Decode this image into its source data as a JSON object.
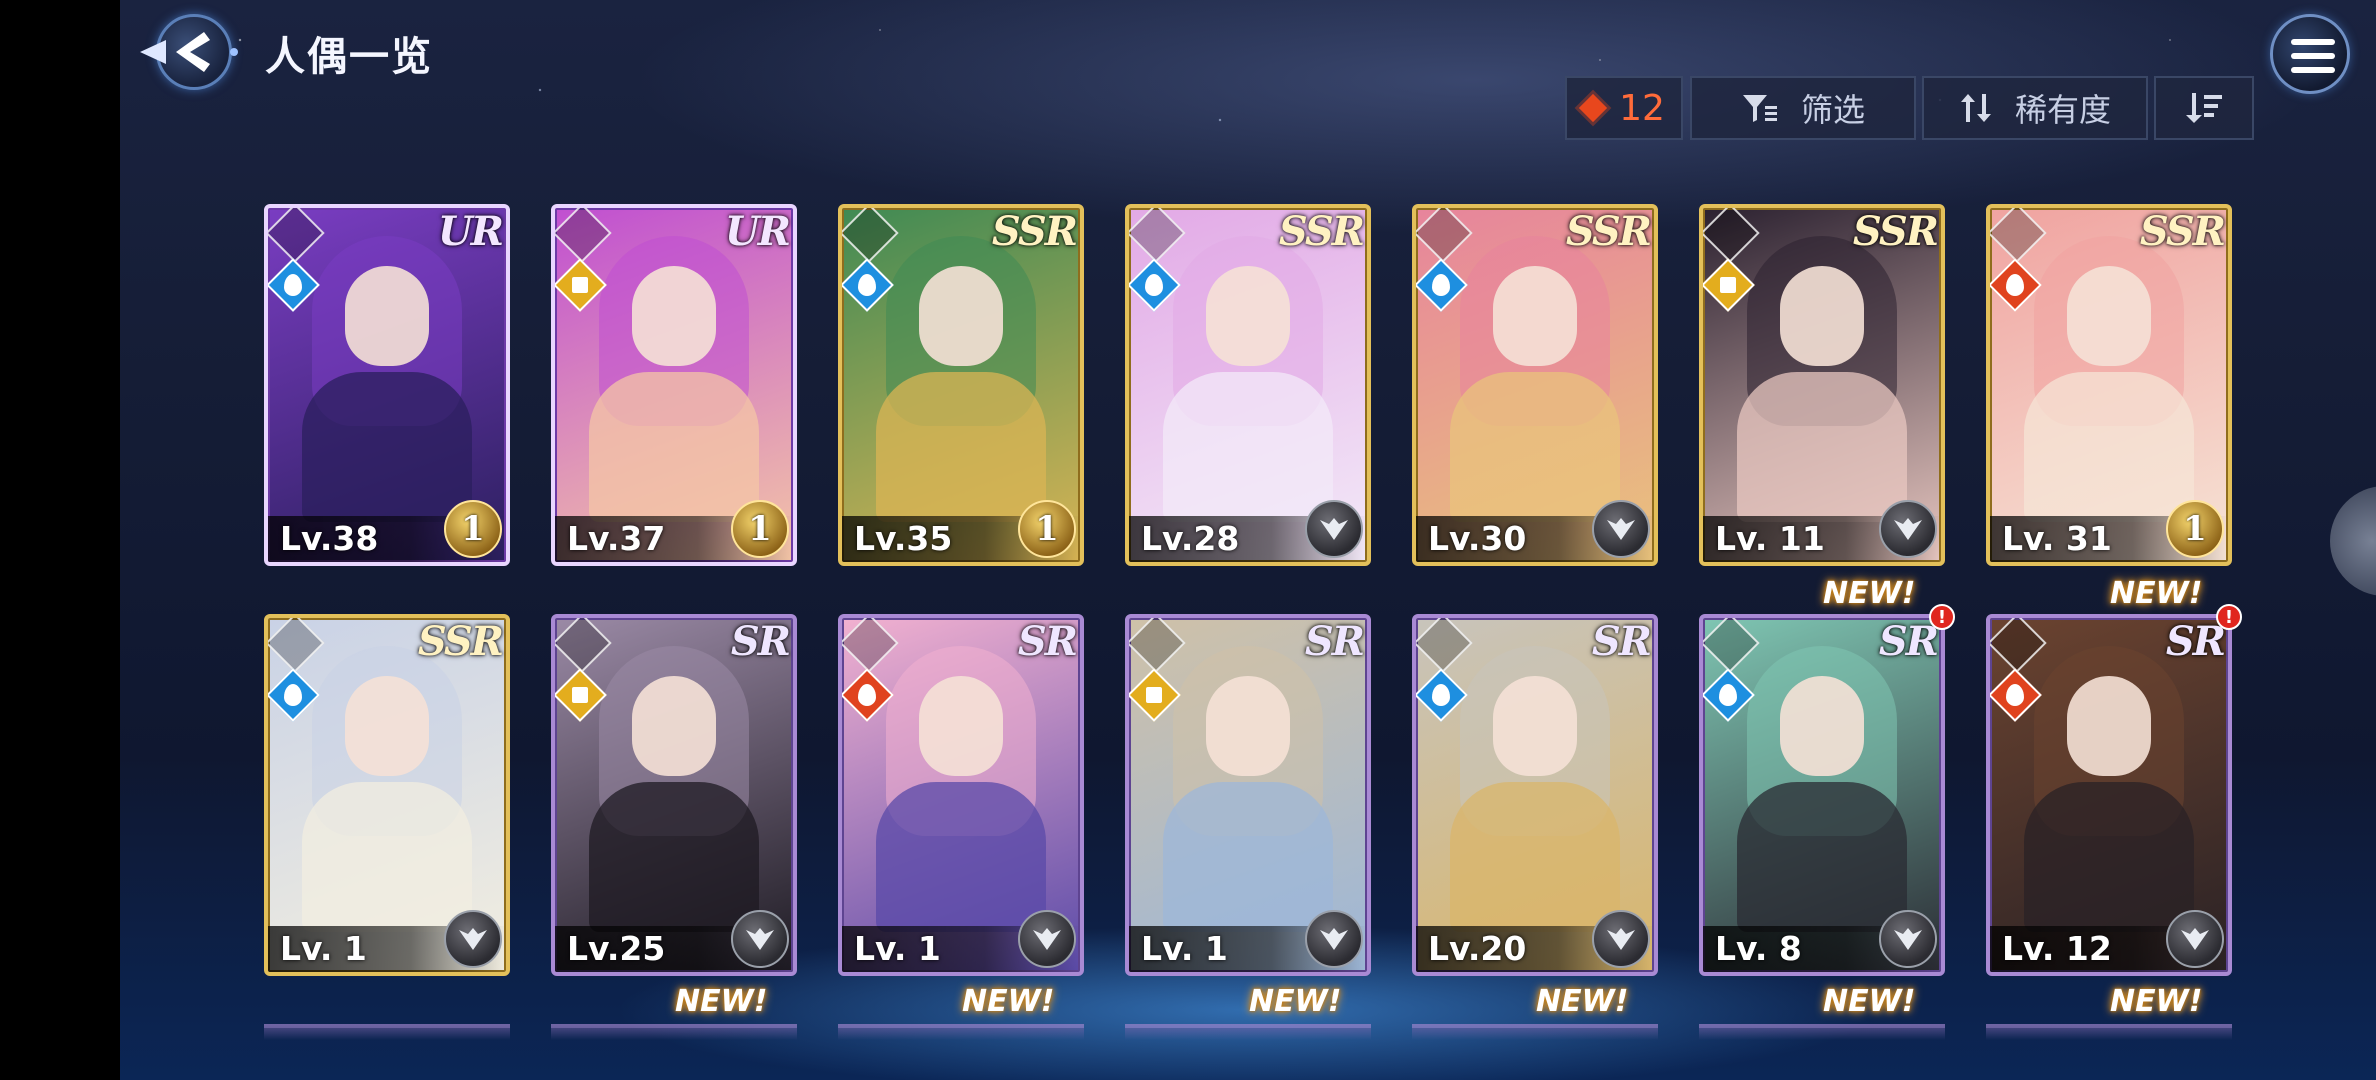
{
  "header": {
    "title": "人偶一览",
    "back_icon": "back-arrow-icon",
    "menu_icon": "hamburger-menu-icon"
  },
  "toolbar": {
    "count": "12",
    "count_icon": "diamond-icon",
    "filter_label": "筛选",
    "filter_icon": "filter-icon",
    "sort_label": "稀有度",
    "sort_icon": "sort-arrows-icon",
    "order_icon": "sort-descending-icon"
  },
  "colors": {
    "count_accent": "#ff6b3a",
    "gold_frame": "#e3c05a",
    "purple_frame": "#a98ad4",
    "water": "#1e8fe0",
    "fire": "#e0431e",
    "light": "#e3ad1e"
  },
  "cards": [
    {
      "rarity": "UR",
      "level": "Lv.38",
      "element": "water",
      "frame": "ur",
      "emblem": "1",
      "palette": [
        "#7a3dc2",
        "#2b1f5e"
      ],
      "new": false,
      "alert": false
    },
    {
      "rarity": "UR",
      "level": "Lv.37",
      "element": "light",
      "frame": "ur",
      "emblem": "1",
      "palette": [
        "#c04fd1",
        "#f4c6a6"
      ],
      "new": false,
      "alert": false
    },
    {
      "rarity": "SSR",
      "level": "Lv.35",
      "element": "water",
      "frame": "gold",
      "emblem": "1",
      "palette": [
        "#3f8a54",
        "#d9b454"
      ],
      "new": false,
      "alert": false
    },
    {
      "rarity": "SSR",
      "level": "Lv.28",
      "element": "water",
      "frame": "gold",
      "emblem": "",
      "palette": [
        "#e2a9e6",
        "#f3eaf8"
      ],
      "new": false,
      "alert": false
    },
    {
      "rarity": "SSR",
      "level": "Lv.30",
      "element": "water",
      "frame": "gold",
      "emblem": "",
      "palette": [
        "#e7849c",
        "#e9c37c"
      ],
      "new": false,
      "alert": false
    },
    {
      "rarity": "SSR",
      "level": "Lv. 11",
      "element": "light",
      "frame": "gold",
      "emblem": "",
      "palette": [
        "#2b2130",
        "#e8c7c0"
      ],
      "new": false,
      "alert": false
    },
    {
      "rarity": "SSR",
      "level": "Lv. 31",
      "element": "fire",
      "frame": "gold",
      "emblem": "1",
      "palette": [
        "#f0a3a0",
        "#f6e4d6"
      ],
      "new": false,
      "alert": false
    },
    {
      "rarity": "SSR",
      "level": "Lv. 1",
      "element": "water",
      "frame": "gold",
      "emblem": "",
      "palette": [
        "#c9d2e6",
        "#f2eee0"
      ],
      "new": false,
      "alert": false
    },
    {
      "rarity": "SR",
      "level": "Lv.25",
      "element": "light",
      "frame": "purple",
      "emblem": "",
      "palette": [
        "#9b8aa6",
        "#1d1a22"
      ],
      "new": false,
      "alert": false
    },
    {
      "rarity": "SR",
      "level": "Lv. 1",
      "element": "fire",
      "frame": "purple",
      "emblem": "",
      "palette": [
        "#f2b1d0",
        "#5a4aa8"
      ],
      "new": false,
      "alert": false
    },
    {
      "rarity": "SR",
      "level": "Lv. 1",
      "element": "light",
      "frame": "purple",
      "emblem": "",
      "palette": [
        "#cfc1a8",
        "#9db7d8"
      ],
      "new": false,
      "alert": false
    },
    {
      "rarity": "SR",
      "level": "Lv.20",
      "element": "water",
      "frame": "purple",
      "emblem": "",
      "palette": [
        "#c8c4bc",
        "#d9b66b"
      ],
      "new": false,
      "alert": false
    },
    {
      "rarity": "SR",
      "level": "Lv. 8",
      "element": "water",
      "frame": "purple",
      "emblem": "",
      "palette": [
        "#7fc6b3",
        "#2a2b33"
      ],
      "new": true,
      "alert": true
    },
    {
      "rarity": "SR",
      "level": "Lv. 12",
      "element": "fire",
      "frame": "purple",
      "emblem": "",
      "palette": [
        "#6b4330",
        "#2a2225"
      ],
      "new": true,
      "alert": true
    }
  ],
  "next_row_new_label": "NEW!",
  "alert_mark": "!"
}
